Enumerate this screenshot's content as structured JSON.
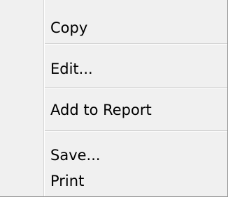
{
  "menu": {
    "items": [
      {
        "label": "Copy"
      },
      {
        "label": "Edit..."
      },
      {
        "label": "Add to Report"
      },
      {
        "label": "Save..."
      },
      {
        "label": "Print"
      }
    ]
  },
  "colors": {
    "background": "#f0f0f0",
    "separator": "#d6d6d6",
    "border": "#979797",
    "text": "#000000"
  }
}
